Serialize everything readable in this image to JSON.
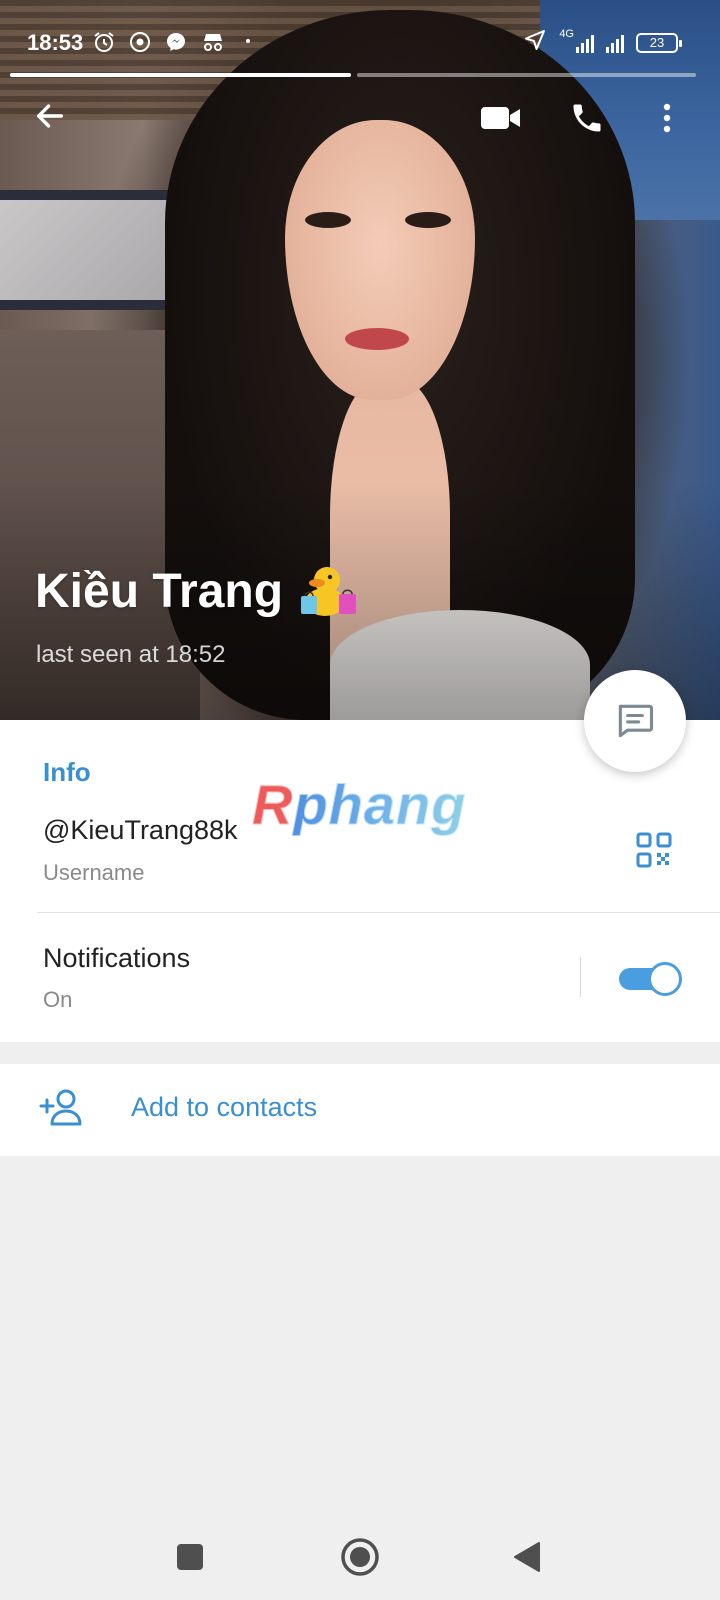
{
  "status_bar": {
    "time": "18:53",
    "left_icons": [
      "alarm-icon",
      "chrome-icon",
      "messenger-icon",
      "incognito-icon",
      "dot-icon"
    ],
    "network_type": "4G",
    "battery_level": "23"
  },
  "story_progress": {
    "segments": 2,
    "active_segment": 1
  },
  "toolbar": {
    "back_icon": "arrow-left-icon",
    "video_call_icon": "video-camera-icon",
    "call_icon": "phone-icon",
    "more_icon": "more-vertical-icon"
  },
  "profile": {
    "name": "Kiều Trang",
    "name_emoji": "duck-with-shopping-bags-emoji",
    "last_seen": "last seen at 18:52"
  },
  "fab": {
    "icon": "message-icon"
  },
  "info": {
    "header": "Info",
    "watermark": "Rphang",
    "username_value": "@KieuTrang88k",
    "username_label": "Username",
    "qr_icon": "qr-code-icon",
    "notifications_label": "Notifications",
    "notifications_value": "On",
    "notifications_enabled": true
  },
  "actions": {
    "add_contact_label": "Add to contacts",
    "add_contact_icon": "add-person-icon"
  },
  "navigation": {
    "recents_icon": "square-icon",
    "home_icon": "home-circle-icon",
    "back_icon": "triangle-back-icon"
  },
  "colors": {
    "accent": "#3a8fd0",
    "toggle": "#4a9ee0",
    "background": "#efefef"
  }
}
